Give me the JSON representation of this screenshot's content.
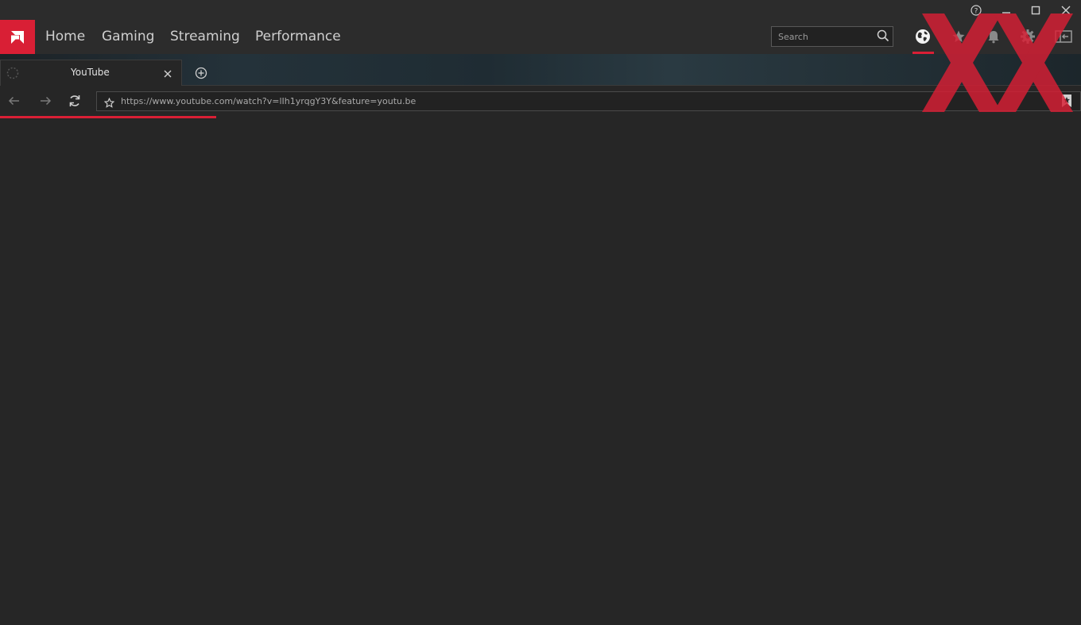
{
  "window_controls": {
    "help_icon": "question-circle",
    "minimize_icon": "minimize",
    "maximize_icon": "maximize",
    "close_icon": "close"
  },
  "nav": {
    "logo_icon": "amd-logo",
    "links": [
      "Home",
      "Gaming",
      "Streaming",
      "Performance"
    ],
    "search_placeholder": "Search",
    "right_icons": [
      "globe-icon",
      "star-icon",
      "bell-icon",
      "gear-icon",
      "sidebar-toggle-icon"
    ],
    "active_icon": "globe-icon"
  },
  "tabs": {
    "items": [
      {
        "title": "YouTube"
      }
    ],
    "new_tab_icon": "plus-circle"
  },
  "urlbar": {
    "url": "https://www.youtube.com/watch?v=lIh1yrqgY3Y&feature=youtu.be"
  },
  "load_progress": 0.2,
  "colors": {
    "accent": "#d91f35",
    "background": "#262626",
    "topbar": "#2c2c2c"
  }
}
